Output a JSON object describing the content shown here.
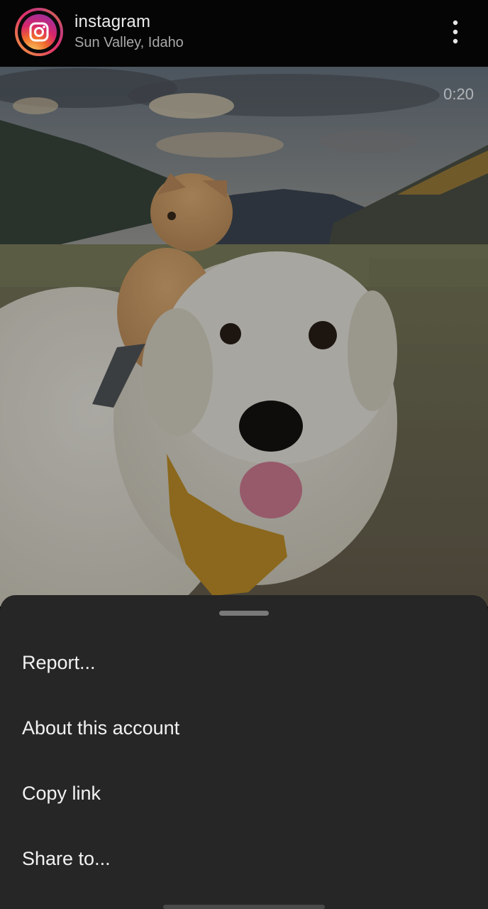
{
  "header": {
    "account_name": "instagram",
    "location": "Sun Valley, Idaho",
    "avatar_icon": "instagram-logo-icon",
    "more_icon": "more-vertical-icon"
  },
  "media": {
    "video_time": "0:20"
  },
  "menu": {
    "items": [
      {
        "label": "Report..."
      },
      {
        "label": "About this account"
      },
      {
        "label": "Copy link"
      },
      {
        "label": "Share to..."
      }
    ]
  },
  "colors": {
    "header_bg": "#050505",
    "sheet_bg": "#262626",
    "text_primary": "#f2f2f2",
    "text_secondary": "#a8a8a8",
    "accent_gradient": [
      "#f9d66b",
      "#f06b2b",
      "#d8266a",
      "#9b2f9f"
    ]
  }
}
